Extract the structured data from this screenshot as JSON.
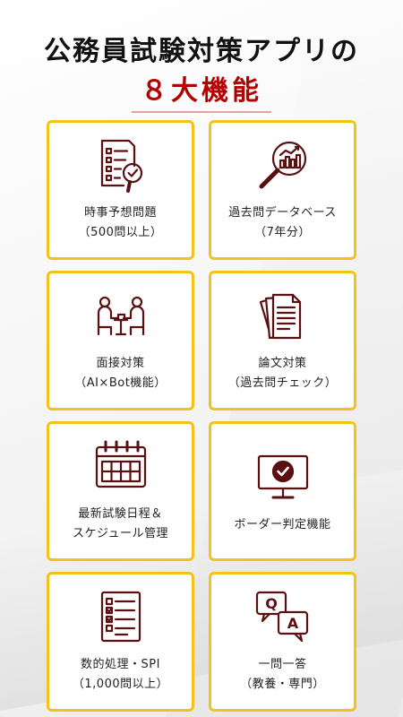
{
  "header": {
    "title": "公務員試験対策アプリの",
    "subtitle": "８大機能"
  },
  "features": [
    {
      "icon": "checklist-magnifier-icon",
      "label": "時事予想問題\n（500問以上）"
    },
    {
      "icon": "chart-magnifier-icon",
      "label": "過去問データベース\n（7年分）"
    },
    {
      "icon": "interview-icon",
      "label": "面接対策\n（AI×Bot機能）"
    },
    {
      "icon": "documents-icon",
      "label": "論文対策\n（過去問チェック）"
    },
    {
      "icon": "calendar-icon",
      "label": "最新試験日程＆\nスケジュール管理"
    },
    {
      "icon": "monitor-check-icon",
      "label": "ボーダー判定機能"
    },
    {
      "icon": "checklist-icon",
      "label": "数的処理・SPI\n（1,000問以上）"
    },
    {
      "icon": "qa-bubbles-icon",
      "label": "一問一答\n（教養・専門）"
    }
  ],
  "colors": {
    "accent": "#b40000",
    "card_border": "#f3c31c",
    "icon": "#5a1010"
  }
}
